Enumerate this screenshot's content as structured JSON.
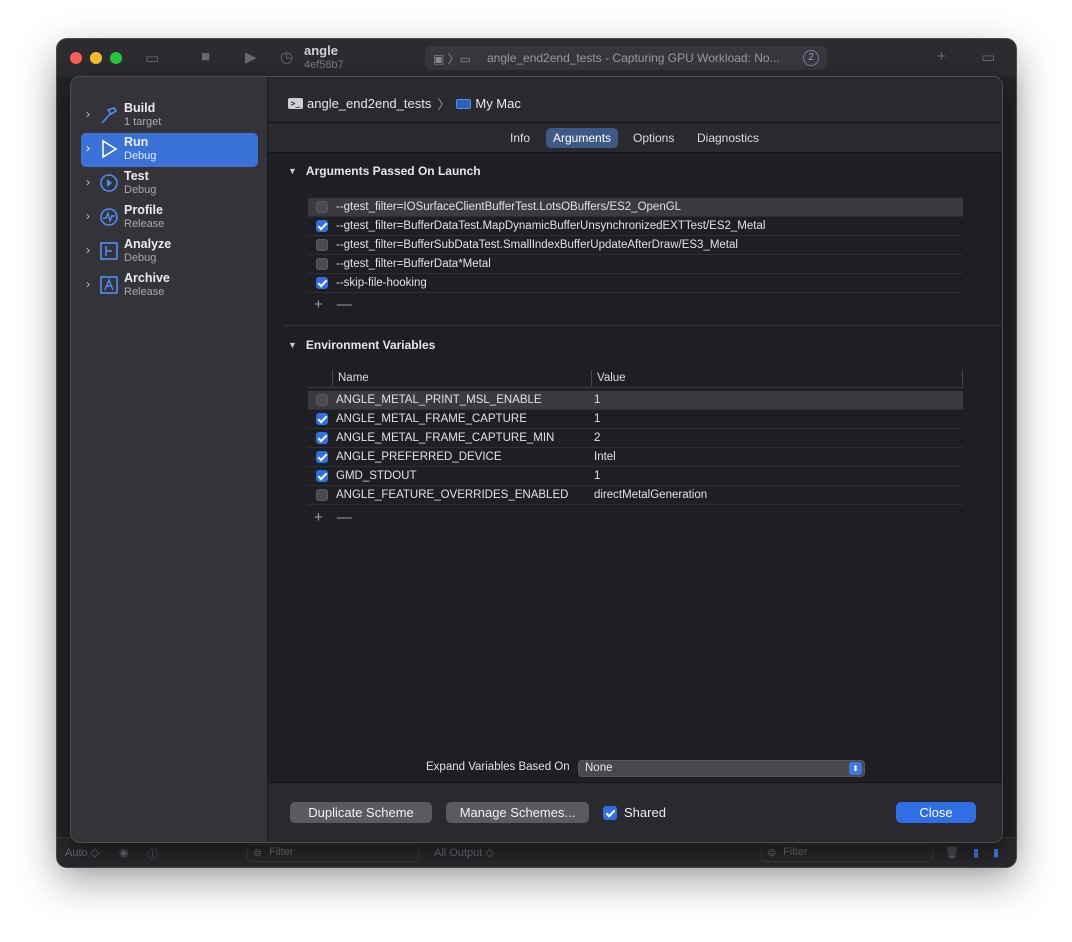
{
  "background_window": {
    "scheme_name": "angle",
    "scheme_sub": "4ef58b7",
    "activity_text": "angle_end2end_tests - Capturing GPU Workload: No...",
    "activity_badge": "2",
    "bottom_auto": "Auto ◇",
    "bottom_filter1": "Filter",
    "bottom_output": "All Output ◇",
    "bottom_filter2": "Filter"
  },
  "sidebar": {
    "items": [
      {
        "title": "Build",
        "subtitle": "1 target",
        "icon": "hammer-icon"
      },
      {
        "title": "Run",
        "subtitle": "Debug",
        "icon": "play-icon"
      },
      {
        "title": "Test",
        "subtitle": "Debug",
        "icon": "test-diamond-icon"
      },
      {
        "title": "Profile",
        "subtitle": "Release",
        "icon": "instruments-icon"
      },
      {
        "title": "Analyze",
        "subtitle": "Debug",
        "icon": "analyze-icon"
      },
      {
        "title": "Archive",
        "subtitle": "Release",
        "icon": "archive-icon"
      }
    ],
    "selected_index": 1
  },
  "header": {
    "target": "angle_end2end_tests",
    "destination": "My Mac"
  },
  "tabs": [
    "Info",
    "Arguments",
    "Options",
    "Diagnostics"
  ],
  "active_tab": "Arguments",
  "arguments": {
    "title": "Arguments Passed On Launch",
    "items": [
      {
        "text": "--gtest_filter=IOSurfaceClientBufferTest.LotsOBuffers/ES2_OpenGL",
        "checked": false
      },
      {
        "text": "--gtest_filter=BufferDataTest.MapDynamicBufferUnsynchronizedEXTTest/ES2_Metal",
        "checked": true
      },
      {
        "text": "--gtest_filter=BufferSubDataTest.SmallIndexBufferUpdateAfterDraw/ES3_Metal",
        "checked": false
      },
      {
        "text": "--gtest_filter=BufferData*Metal",
        "checked": false
      },
      {
        "text": "--skip-file-hooking",
        "checked": true
      }
    ],
    "add_label": "+",
    "remove_label": "—"
  },
  "environment": {
    "title": "Environment Variables",
    "col_name": "Name",
    "col_value": "Value",
    "items": [
      {
        "name": "ANGLE_METAL_PRINT_MSL_ENABLE",
        "value": "1",
        "checked": false
      },
      {
        "name": "ANGLE_METAL_FRAME_CAPTURE",
        "value": "1",
        "checked": true
      },
      {
        "name": "ANGLE_METAL_FRAME_CAPTURE_MIN",
        "value": "2",
        "checked": true
      },
      {
        "name": "ANGLE_PREFERRED_DEVICE",
        "value": "Intel",
        "checked": true
      },
      {
        "name": "GMD_STDOUT",
        "value": "1",
        "checked": true
      },
      {
        "name": "ANGLE_FEATURE_OVERRIDES_ENABLED",
        "value": "directMetalGeneration",
        "checked": false
      }
    ],
    "add_label": "+",
    "remove_label": "—"
  },
  "expand": {
    "label": "Expand Variables Based On",
    "value": "None"
  },
  "footer": {
    "duplicate": "Duplicate Scheme",
    "manage": "Manage Schemes...",
    "shared_label": "Shared",
    "shared_checked": true,
    "close": "Close"
  },
  "colors": {
    "accent": "#3b72d9",
    "checkbox_on": "#2f6fe6",
    "sheet_bg": "#1f1f23"
  }
}
